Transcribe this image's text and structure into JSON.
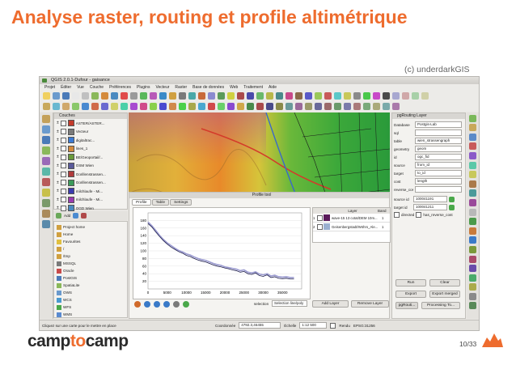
{
  "slide": {
    "title": "Analyse raster, routing et profile altimétrique",
    "credit": "(c) underdarkGIS",
    "logo_prefix": "camp",
    "logo_mid": "to",
    "logo_suffix": "camp",
    "page_number": "10/33",
    "accent_color": "#ee6c2e"
  },
  "window": {
    "title": "QGIS 2.0.1-Dufour - gaisance",
    "menu": [
      "Projet",
      "Éditer",
      "Vue",
      "Couche",
      "Préférences",
      "Plugins",
      "Vecteur",
      "Raster",
      "Base de données",
      "Web",
      "Traitement",
      "Aide"
    ]
  },
  "layers_panel": {
    "title": "Couches",
    "items": [
      {
        "label": "ASTER/ASTER...",
        "color": "#c33b2b"
      },
      {
        "label": "Vecteur",
        "color": "#7a7a7a"
      },
      {
        "label": "digitaltrac...",
        "color": "#3b7ad4"
      },
      {
        "label": "lines_1",
        "color": "#d48a3b"
      },
      {
        "label": "BE/Geoportail/...",
        "color": "#6a9a3b"
      },
      {
        "label": "OSM Wien",
        "color": "#5a5a9a"
      },
      {
        "label": "Gorillenstrassen...",
        "color": "#b03b3b"
      },
      {
        "label": "Gorillenstrassen...",
        "color": "#3b9a5a"
      },
      {
        "label": "milchlaufe - Mi...",
        "color": "#3b3bb0"
      },
      {
        "label": "milchlaufe - Mi...",
        "color": "#9a3bb0"
      },
      {
        "label": "OGD Wien",
        "color": "#4a8ac0"
      },
      {
        "label": "TIFF_DGM10",
        "color": "#8a5a2a"
      },
      {
        "label": "ASTER_...",
        "color": "#2a9a2a"
      },
      {
        "label": "digitalwalks...",
        "color": "#aa7a1a"
      }
    ],
    "add_button": "Add"
  },
  "browser_panel": {
    "title": "Browser",
    "items": [
      "Project home",
      "Home",
      "Favourites",
      "/",
      "/tmp",
      "MSSQL",
      "Oracle",
      "PostGIS",
      "SpatiaLite",
      "OWS",
      "WCS",
      "WFS",
      "WMS"
    ]
  },
  "profile_tool": {
    "title": "Profile tool",
    "tabs": [
      "Profile",
      "Table",
      "Settings"
    ],
    "y_ticks": [
      "180",
      "160",
      "140",
      "120",
      "100",
      "80",
      "60",
      "40",
      "20"
    ],
    "x_ticks": [
      "0",
      "5000",
      "10000",
      "15000",
      "20000",
      "25000",
      "30000",
      "35000"
    ],
    "layers_header": [
      "",
      "Layer",
      "Band"
    ],
    "layers": [
      {
        "name": "wave-15 13 cotat/DEM 10m...",
        "band": "1"
      },
      {
        "name": "Geisenbergstadt/Wöhrs_Ale...",
        "band": "1"
      }
    ],
    "selection_label": "selection",
    "selection_value": "Selection line/poly",
    "add_layer": "Add Layer",
    "remove_layer": "Remove Layer",
    "chart_data": {
      "type": "line",
      "title": "",
      "xlabel": "",
      "ylabel": "",
      "xlim": [
        0,
        40000
      ],
      "ylim": [
        0,
        200
      ],
      "series": [
        {
          "color": "#1a1a4a",
          "x": [
            0,
            1000,
            2000,
            3000,
            4000,
            5000,
            6000,
            7000,
            8000,
            9000,
            10000,
            11000,
            12000,
            13000,
            14000,
            15000,
            16000,
            17000,
            18000,
            19000,
            20000,
            21000,
            22000,
            23000,
            24000,
            25000,
            26000,
            27000,
            28000,
            29000,
            30000,
            31000,
            32000,
            33000,
            34000,
            35000,
            36000,
            37000,
            38000
          ],
          "y": [
            172,
            163,
            150,
            138,
            127,
            118,
            110,
            104,
            98,
            94,
            88,
            85,
            80,
            76,
            73,
            71,
            67,
            63,
            60,
            58,
            55,
            53,
            50,
            48,
            44,
            46,
            40,
            38,
            42,
            35,
            33,
            37,
            30,
            32,
            28,
            27,
            28,
            26,
            26
          ]
        },
        {
          "color": "#9a9ad0",
          "x": [
            0,
            1000,
            2000,
            3000,
            4000,
            5000,
            6000,
            7000,
            8000,
            9000,
            10000,
            11000,
            12000,
            13000,
            14000,
            15000,
            16000,
            17000,
            18000,
            19000,
            20000,
            21000,
            22000,
            23000,
            24000,
            25000,
            26000,
            27000,
            28000,
            29000,
            30000,
            31000,
            32000,
            33000,
            34000,
            35000,
            36000,
            37000,
            38000
          ],
          "y": [
            176,
            166,
            154,
            141,
            130,
            121,
            114,
            107,
            101,
            97,
            92,
            89,
            84,
            80,
            77,
            75,
            71,
            67,
            64,
            62,
            58,
            56,
            54,
            52,
            48,
            50,
            44,
            42,
            45,
            39,
            37,
            40,
            34,
            36,
            32,
            31,
            32,
            30,
            30
          ]
        }
      ]
    },
    "icons": [
      "home-icon",
      "zoom-in-icon",
      "zoom-out-icon",
      "pan-icon",
      "edit-icon",
      "check-icon"
    ]
  },
  "routing_panel": {
    "title": "pgRouting Layer",
    "fields": [
      {
        "label": "Database",
        "value": "Postgis-Lab"
      },
      {
        "label": "sql",
        "value": ""
      },
      {
        "label": "table",
        "value": "wien_strassengraph"
      },
      {
        "label": "geometry",
        "value": "geom"
      },
      {
        "label": "id",
        "value": "ogc_fid"
      },
      {
        "label": "source",
        "value": "from_id"
      },
      {
        "label": "target",
        "value": "to_id"
      },
      {
        "label": "cost",
        "value": "length"
      },
      {
        "label": "reverse_cost",
        "value": ""
      }
    ],
    "source_id_label": "source id",
    "source_id_value": "100041191",
    "target_id_label": "target id",
    "target_id_value": "100041211",
    "checkbox_directed": "directed",
    "checkbox_reverse": "has_reverse_cost",
    "buttons": [
      "Run",
      "Clear",
      "Export",
      "Export merged"
    ],
    "processing": "Processing To..."
  },
  "statusbar": {
    "hint": "Cliquez sur une carte pour le mettre en place",
    "coordinate_label": "Coordonnée",
    "coordinate_value": "4792.3,46455",
    "scale_label": "Échelle",
    "scale_value": "1:12 500",
    "render_label": "Rendu",
    "crs": "EPSG:31256"
  }
}
